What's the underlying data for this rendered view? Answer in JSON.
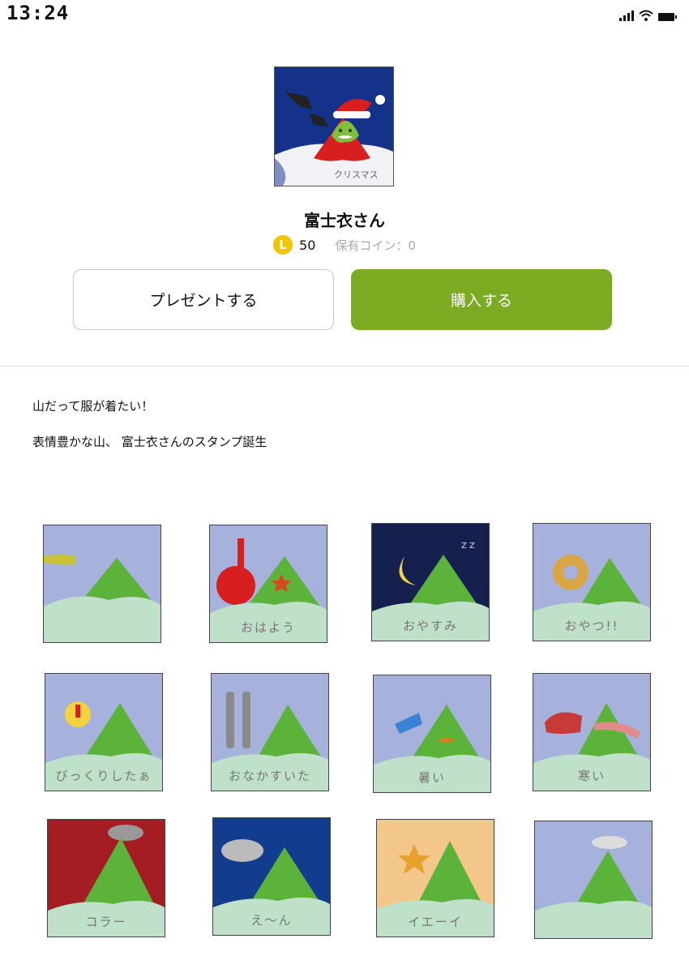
{
  "status_bar": {
    "time": "13:24"
  },
  "sticker": {
    "title": "富士衣さん",
    "hero_caption": "クリスマス",
    "price": "50",
    "coin_symbol": "L",
    "owned_coins": "保有コイン：0"
  },
  "actions": {
    "gift_label": "プレゼントする",
    "buy_label": "購入する"
  },
  "description": {
    "line1": "山だって服が着たい！",
    "line2": "表情豊かな山、 富士衣さんのスタンプ誕生"
  },
  "stamps": [
    {
      "name": "sun-mountain",
      "caption": ""
    },
    {
      "name": "good-morning",
      "caption": "おはよう"
    },
    {
      "name": "good-night",
      "caption": "おやすみ"
    },
    {
      "name": "snack",
      "caption": "おやつ!!"
    },
    {
      "name": "surprised",
      "caption": "びっくりしたぁ"
    },
    {
      "name": "hungry",
      "caption": "おなかすいた"
    },
    {
      "name": "hot",
      "caption": "暑い"
    },
    {
      "name": "cold",
      "caption": "寒い"
    },
    {
      "name": "angry",
      "caption": "コラー"
    },
    {
      "name": "crying",
      "caption": "え～ん"
    },
    {
      "name": "yay",
      "caption": "イエーイ"
    },
    {
      "name": "cloud-hat",
      "caption": ""
    }
  ],
  "colors": {
    "buy_button": "#7aab21",
    "coin": "#f3c400",
    "mountain": "#5cb33a",
    "sky": "#a6b2dc",
    "snow": "#bfe0c9"
  }
}
